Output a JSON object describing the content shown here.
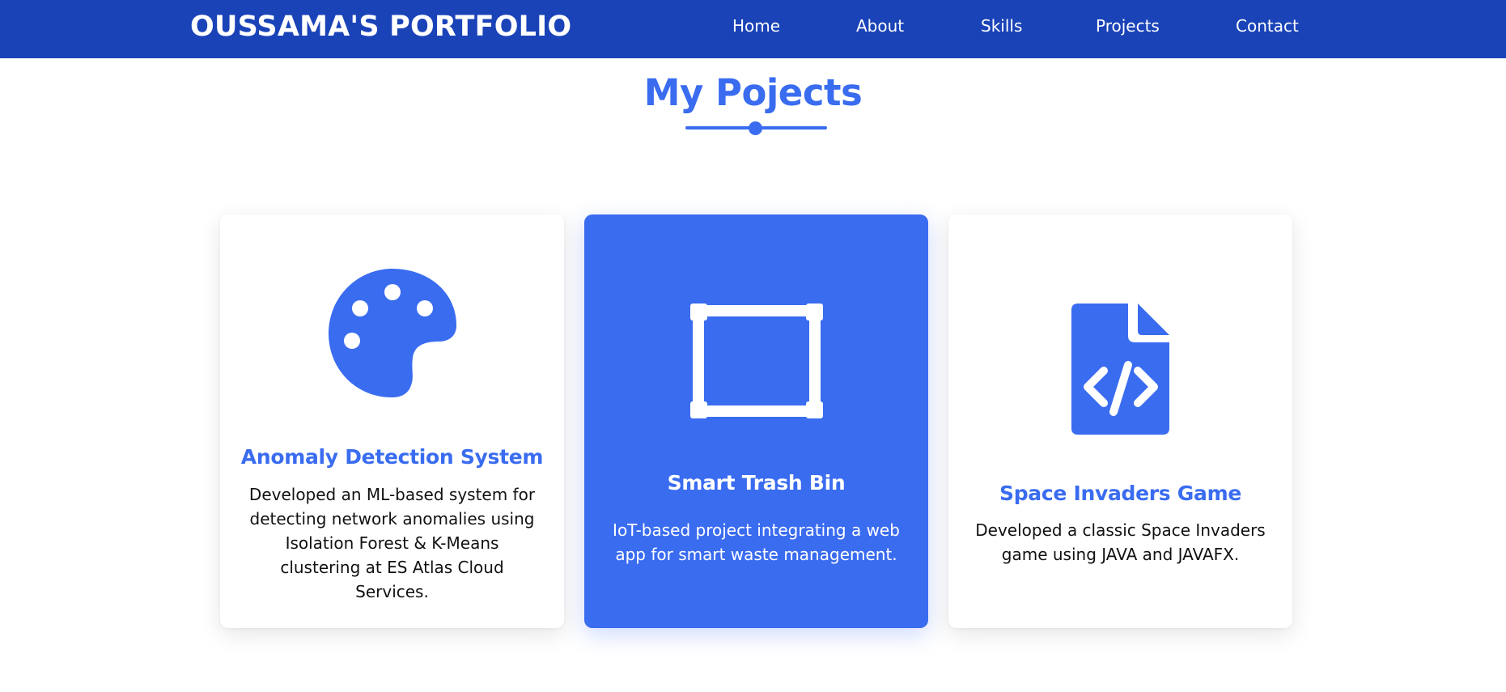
{
  "header": {
    "brand": "OUSSAMA'S PORTFOLIO",
    "nav": [
      {
        "label": "Home"
      },
      {
        "label": "About"
      },
      {
        "label": "Skills"
      },
      {
        "label": "Projects"
      },
      {
        "label": "Contact"
      }
    ],
    "background_color": "#1a43b8"
  },
  "section": {
    "title": "My Pojects",
    "accent_color": "#3a6cf0"
  },
  "projects": [
    {
      "icon": "palette-icon",
      "title": "Anomaly Detection System",
      "description": "Developed an ML-based system for detecting network anomalies using Isolation Forest & K-Means clustering at ES Atlas Cloud Services.",
      "highlighted": false
    },
    {
      "icon": "vector-square-icon",
      "title": "Smart Trash Bin",
      "description": "IoT-based project integrating a web app for smart waste management.",
      "highlighted": true
    },
    {
      "icon": "file-code-icon",
      "title": "Space Invaders Game",
      "description": "Developed a classic Space Invaders game using JAVA and JAVAFX.",
      "highlighted": false
    }
  ]
}
